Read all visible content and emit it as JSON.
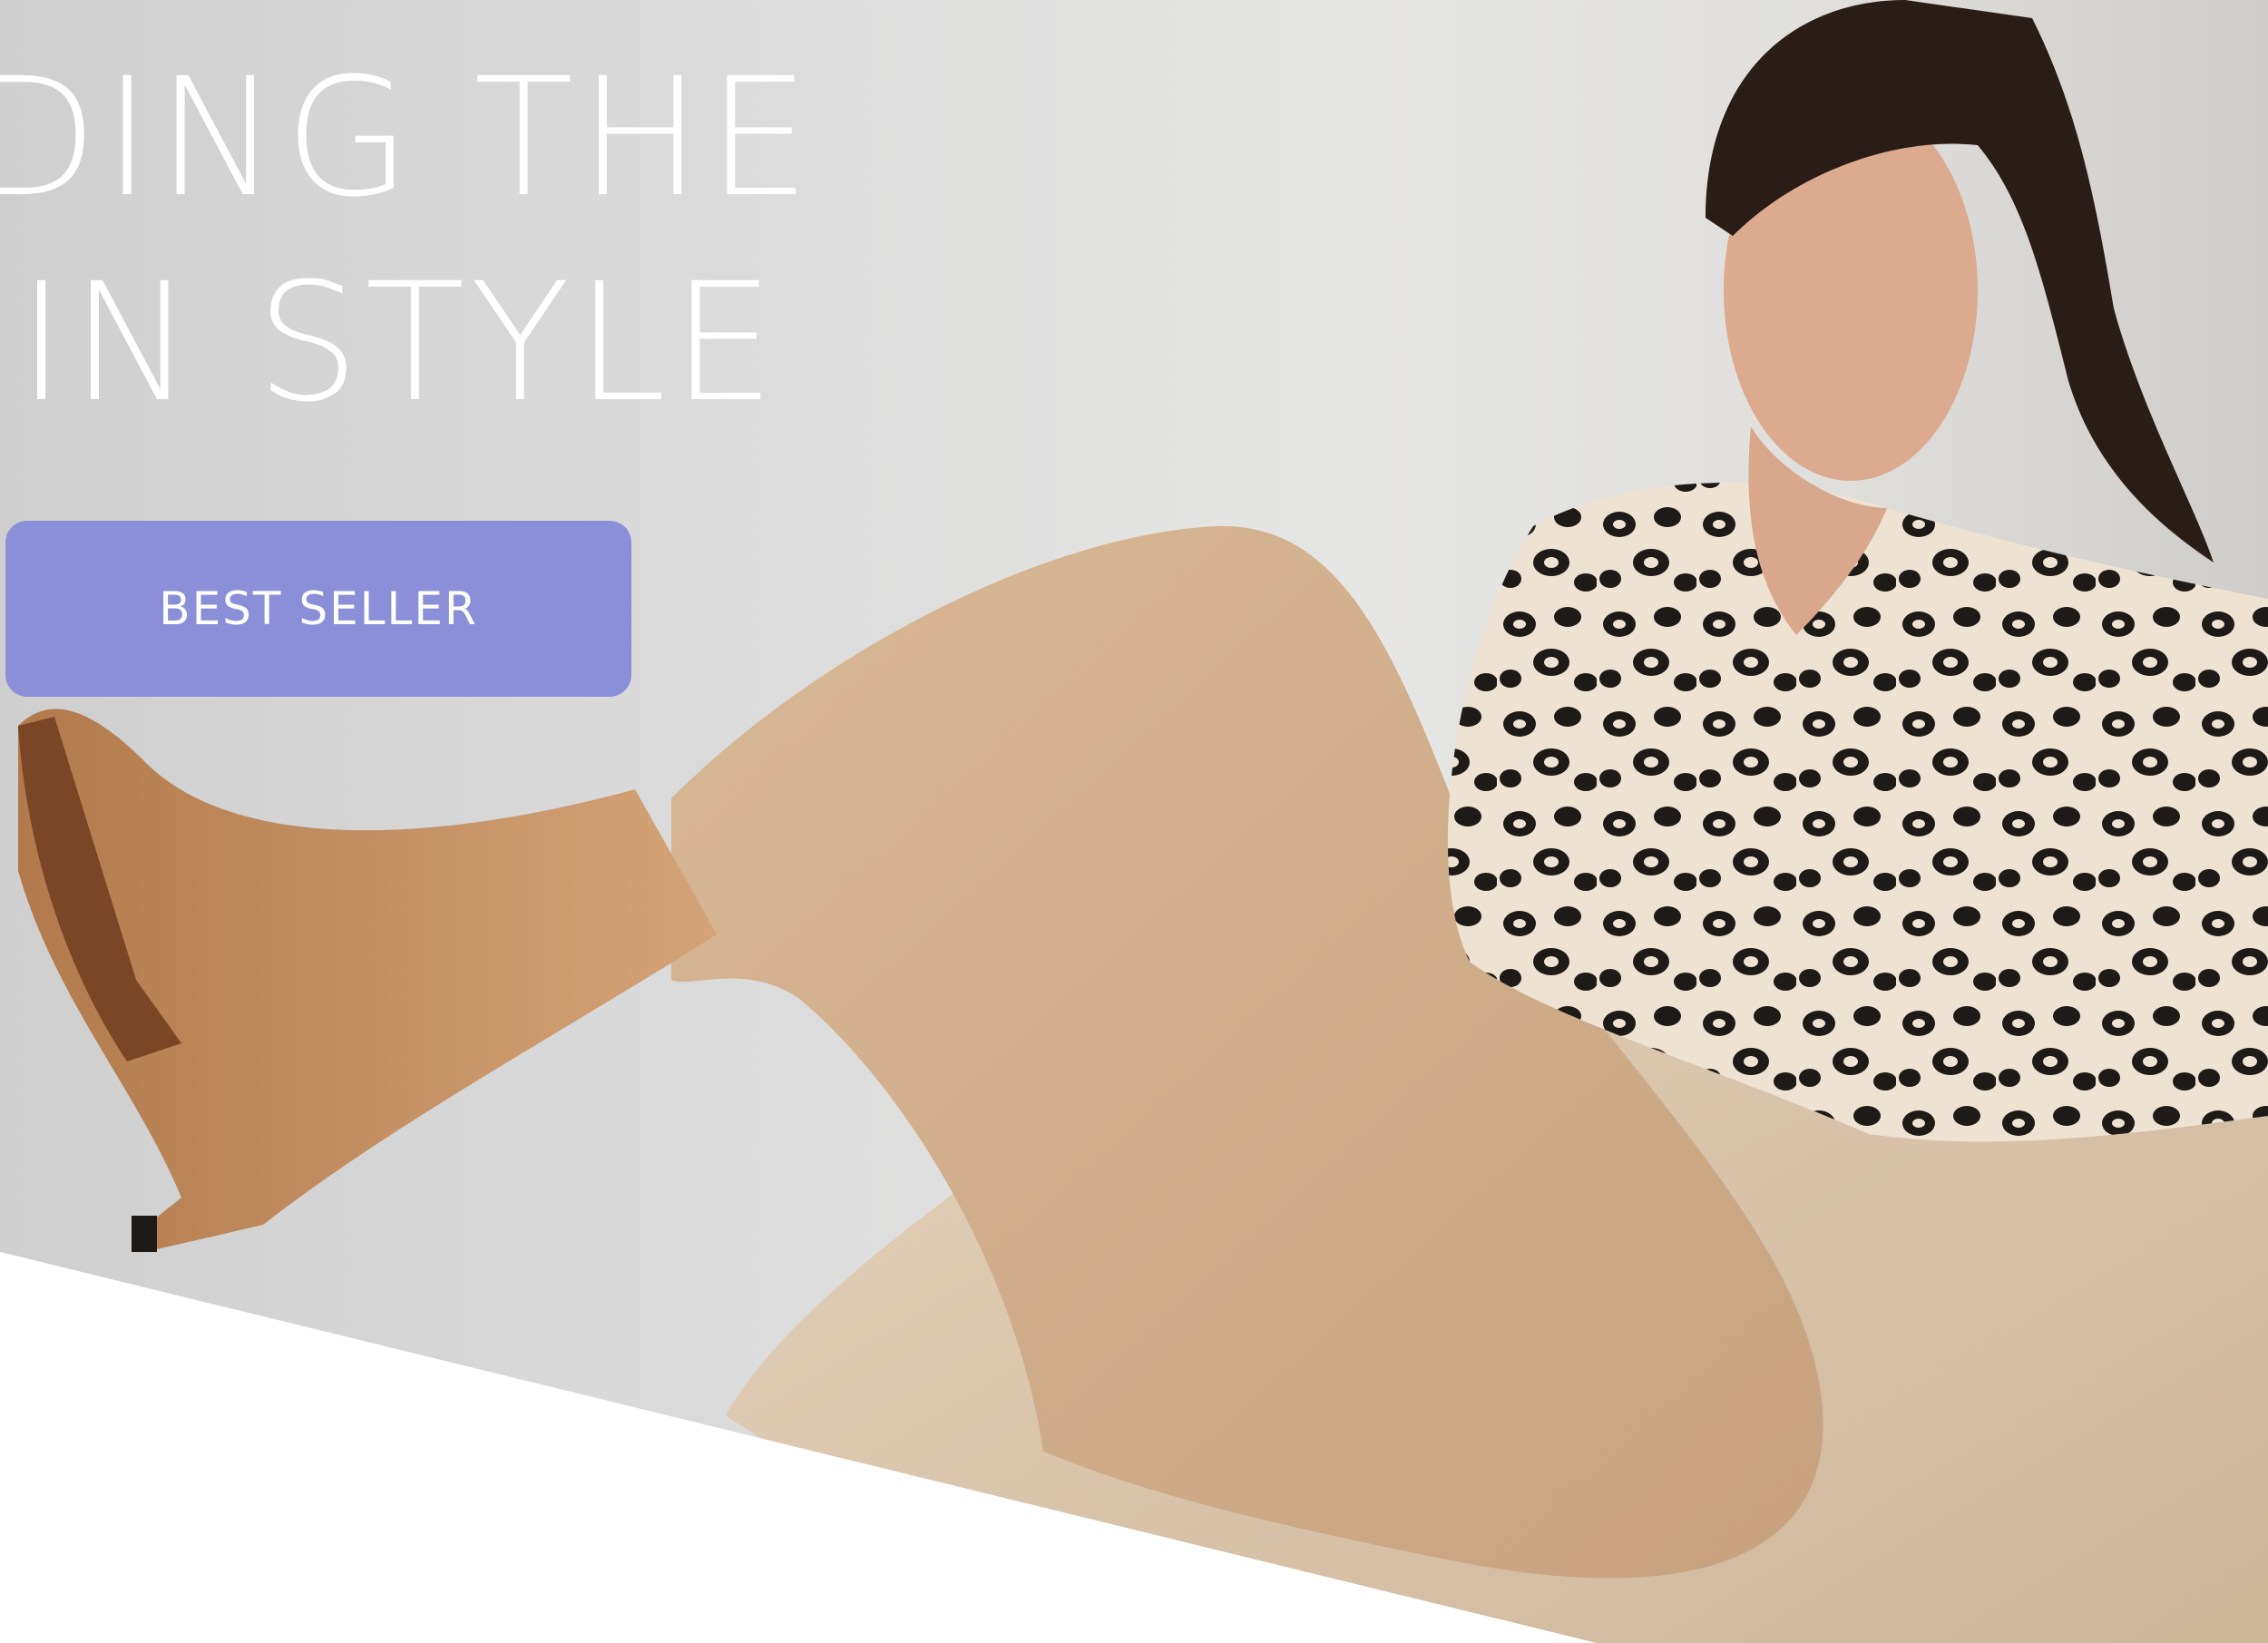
{
  "hero": {
    "headline_line1": "ADING THE",
    "headline_line2": "Y IN STYLE",
    "cta_label": "BEST SELLER",
    "cta_color": "#8b8fd8",
    "background_color": "#dcdcdc",
    "image_alt": "Model in leopard print satin blouse, beige trousers, tan heeled boots and shearling coat"
  }
}
